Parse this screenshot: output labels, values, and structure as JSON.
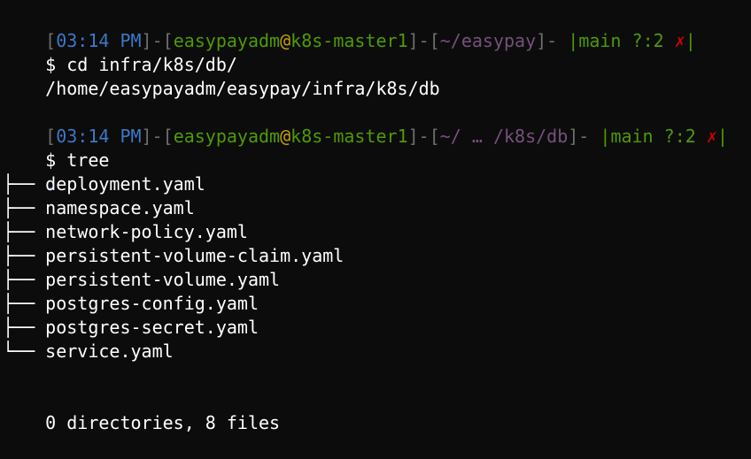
{
  "colors": {
    "background": "#0c0c0c",
    "time": "#3b78c7",
    "user_host": "#4e9a06",
    "at": "#c4a000",
    "path": "#75507b",
    "dirty_mark": "#cc0000",
    "bracket": "#6e6e6e",
    "text": "#ffffff"
  },
  "prompts": [
    {
      "time": "03:14 PM",
      "user": "easypayadm",
      "at": "@",
      "host": "k8s-master1",
      "path": "~/easypay",
      "branch": "main",
      "status": "?:2",
      "dirty": "✗",
      "symbol": "$",
      "command": "cd infra/k8s/db/"
    },
    {
      "time": "03:14 PM",
      "user": "easypayadm",
      "at": "@",
      "host": "k8s-master1",
      "path": "~/ … /k8s/db",
      "branch": "main",
      "status": "?:2",
      "dirty": "✗",
      "symbol": "$",
      "command": "tree"
    }
  ],
  "outputs": {
    "pwd_result": "/home/easypayadm/easypay/infra/k8s/db",
    "tree_root": ".",
    "tree_items": [
      {
        "branch": "├── ",
        "name": "deployment.yaml"
      },
      {
        "branch": "├── ",
        "name": "namespace.yaml"
      },
      {
        "branch": "├── ",
        "name": "network-policy.yaml"
      },
      {
        "branch": "├── ",
        "name": "persistent-volume-claim.yaml"
      },
      {
        "branch": "├── ",
        "name": "persistent-volume.yaml"
      },
      {
        "branch": "├── ",
        "name": "postgres-config.yaml"
      },
      {
        "branch": "├── ",
        "name": "postgres-secret.yaml"
      },
      {
        "branch": "└── ",
        "name": "service.yaml"
      }
    ],
    "summary": "0 directories, 8 files"
  }
}
